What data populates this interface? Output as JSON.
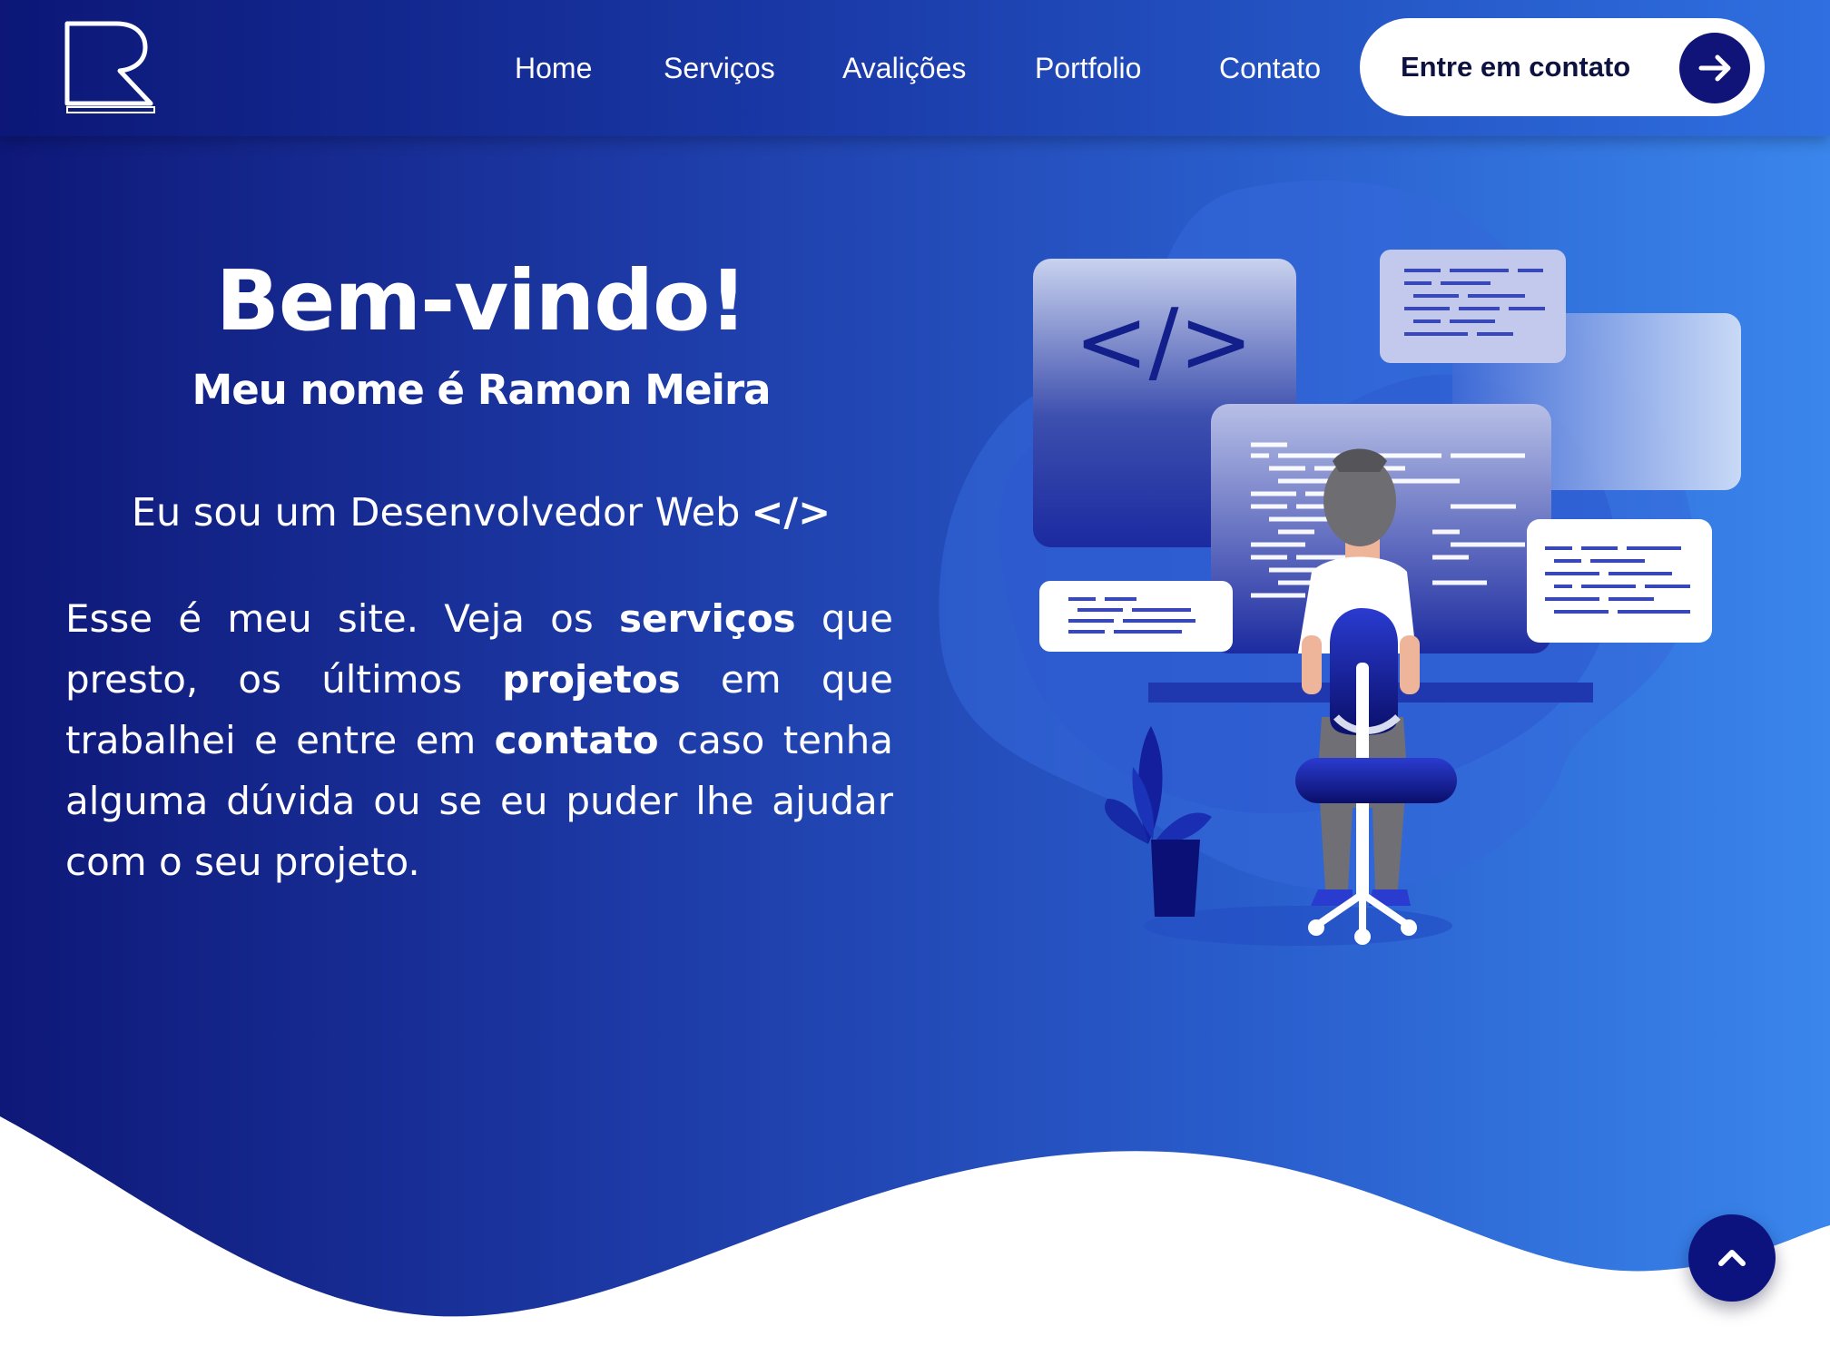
{
  "header": {
    "logo_alt": "logo",
    "nav": [
      {
        "label": "Home"
      },
      {
        "label": "Serviços"
      },
      {
        "label": "Avalições"
      },
      {
        "label": "Portfolio"
      },
      {
        "label": "Contato"
      }
    ],
    "cta_label": "Entre em contato",
    "cta_icon": "arrow-right-icon"
  },
  "hero": {
    "title": "Bem-vindo!",
    "subtitle": "Meu nome é Ramon Meira",
    "role": "Eu sou um Desenvolvedor Web",
    "role_icon_text": "</>",
    "intro": {
      "p1": "Esse é meu site. Veja os ",
      "b1": "serviços",
      "p2": " que presto, os últimos ",
      "b2": "projetos",
      "p3": " em que trabalhei e entre em ",
      "b3": "contato",
      "p4": " caso tenha alguma dúvida ou se eu puder lhe ajudar com o seu projeto."
    },
    "illustration_code_text": "</>"
  },
  "scroll_top_icon": "chevron-up-icon",
  "colors": {
    "navy": "#101478",
    "hero_start": "#0e1878",
    "hero_end": "#3a86ec",
    "white": "#ffffff"
  }
}
